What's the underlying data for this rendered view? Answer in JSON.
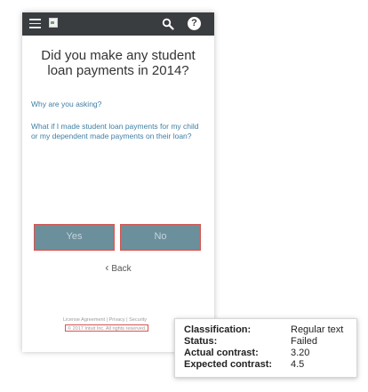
{
  "header": {
    "icons": [
      "menu-icon",
      "broken-image-icon",
      "search-icon",
      "help-icon"
    ],
    "help_glyph": "?"
  },
  "main": {
    "question": "Did you make any student loan payments in 2014?",
    "link_why": "Why are you asking?",
    "link_child": "What if I made student loan payments for my child or my dependent made payments on their loan?"
  },
  "buttons": {
    "yes": "Yes",
    "no": "No"
  },
  "back": {
    "label": "Back"
  },
  "footer": {
    "license": "License Agreement",
    "separator": "|",
    "privacy": "Privacy",
    "security": "Security",
    "copyright": "© 2017 Intuit Inc. All rights reserved."
  },
  "tooltip": {
    "classification_label": "Classification:",
    "classification_value": "Regular text",
    "status_label": "Status:",
    "status_value": "Failed",
    "actual_label": "Actual contrast:",
    "actual_value": "3.20",
    "expected_label": "Expected contrast:",
    "expected_value": "4.5"
  },
  "colors": {
    "topbar": "#3a3d3f",
    "button_fill": "#6b8f9b",
    "highlight_border": "#d9534f",
    "link": "#3e7fa5"
  }
}
